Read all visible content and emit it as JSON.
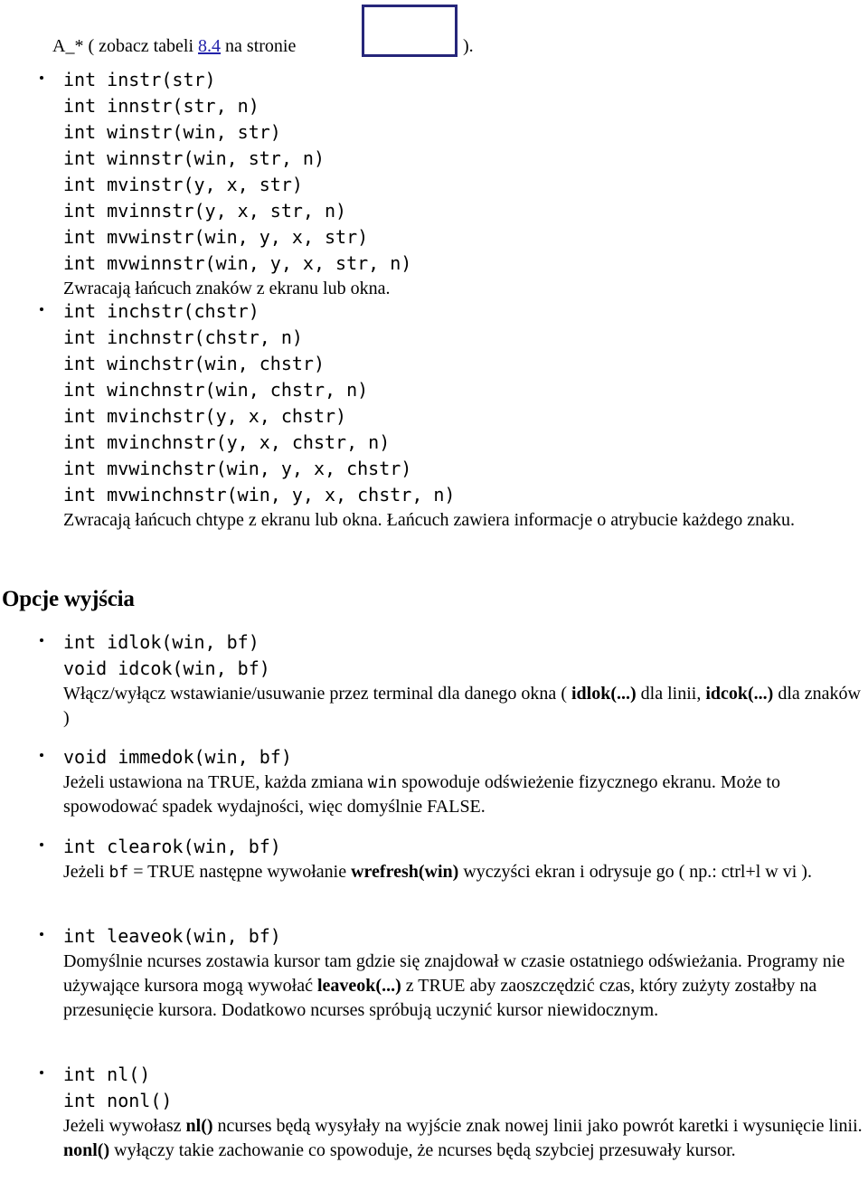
{
  "page": {
    "language": "pl",
    "background": "#ffffff",
    "text_color": "#000000",
    "link_color": "#2222aa",
    "box_border_color": "#26267a"
  },
  "intro": {
    "prefix": "A_* ( zobacz tabeli ",
    "link": "8.4",
    "middle": " na stronie ",
    "suffix": ")."
  },
  "bullets": [
    {
      "id": "instr-family",
      "code": "int instr(str)\nint innstr(str, n)\nint winstr(win, str)\nint winnstr(win, str, n)\nint mvinstr(y, x, str)\nint mvinnstr(y, x, str, n)\nint mvwinstr(win, y, x, str)\nint mvwinnstr(win, y, x, str, n)",
      "desc_parts": [
        {
          "t": "Zwracają łańcuch znaków z ekranu lub okna.",
          "style": "normal"
        }
      ]
    },
    {
      "id": "inchstr-family",
      "code": "int inchstr(chstr)\nint inchnstr(chstr, n)\nint winchstr(win, chstr)\nint winchnstr(win, chstr, n)\nint mvinchstr(y, x, chstr)\nint mvinchnstr(y, x, chstr, n)\nint mvwinchstr(win, y, x, chstr)\nint mvwinchnstr(win, y, x, chstr, n)",
      "desc_parts": [
        {
          "t": "Zwracają łańcuch chtype z ekranu lub okna. Łańcuch zawiera informacje o atrybucie każdego znaku.",
          "style": "normal"
        }
      ]
    },
    {
      "id": "idlok-idcok",
      "code": "int idlok(win, bf)\nvoid idcok(win, bf)",
      "desc_parts": [
        {
          "t": "Włącz/wyłącz wstawianie/usuwanie przez terminal dla danego okna ( ",
          "style": "normal"
        },
        {
          "t": "idlok(...)",
          "style": "bold"
        },
        {
          "t": " dla linii, ",
          "style": "normal"
        },
        {
          "t": "idcok(...)",
          "style": "bold"
        },
        {
          "t": " dla znaków )",
          "style": "normal"
        }
      ]
    },
    {
      "id": "immedok",
      "code": "void immedok(win, bf)",
      "desc_parts": [
        {
          "t": "Jeżeli ustawiona na TRUE, każda zmiana ",
          "style": "normal"
        },
        {
          "t": "win",
          "style": "mono"
        },
        {
          "t": " spowoduje odświeżenie fizycznego ekranu. Może to spowodować spadek wydajności, więc domyślnie FALSE.",
          "style": "normal"
        }
      ]
    },
    {
      "id": "clearok",
      "code": "int clearok(win, bf)",
      "desc_parts": [
        {
          "t": "Jeżeli ",
          "style": "normal"
        },
        {
          "t": "bf",
          "style": "mono"
        },
        {
          "t": " = TRUE następne wywołanie ",
          "style": "normal"
        },
        {
          "t": "wrefresh(win)",
          "style": "bold"
        },
        {
          "t": " wyczyści ekran i odrysuje go ( np.: ctrl+l w vi ).",
          "style": "normal"
        }
      ]
    },
    {
      "id": "leaveok",
      "code": "int leaveok(win, bf)",
      "desc_parts": [
        {
          "t": "Domyślnie ncurses zostawia kursor tam gdzie się znajdował w czasie ostatniego odświeżania. Programy nie używające kursora mogą wywołać ",
          "style": "normal"
        },
        {
          "t": "leaveok(...)",
          "style": "bold"
        },
        {
          "t": " z TRUE aby zaoszczędzić czas, który zużyty zostałby na przesunięcie kursora. Dodatkowo ncurses spróbują uczynić kursor niewidocznym.",
          "style": "normal"
        }
      ]
    },
    {
      "id": "nl-nonl",
      "code": "int nl()\nint nonl()",
      "desc_parts": [
        {
          "t": "Jeżeli wywołasz ",
          "style": "normal"
        },
        {
          "t": "nl()",
          "style": "bold"
        },
        {
          "t": " ncurses będą wysyłały na wyjście znak nowej linii jako powrót karetki i wysunięcie linii. ",
          "style": "normal"
        },
        {
          "t": "nonl()",
          "style": "bold"
        },
        {
          "t": " wyłączy takie zachowanie co spowoduje, że ncurses będą szybciej przesuwały kursor.",
          "style": "normal"
        }
      ]
    }
  ],
  "section_heading": "Opcje wyjścia"
}
